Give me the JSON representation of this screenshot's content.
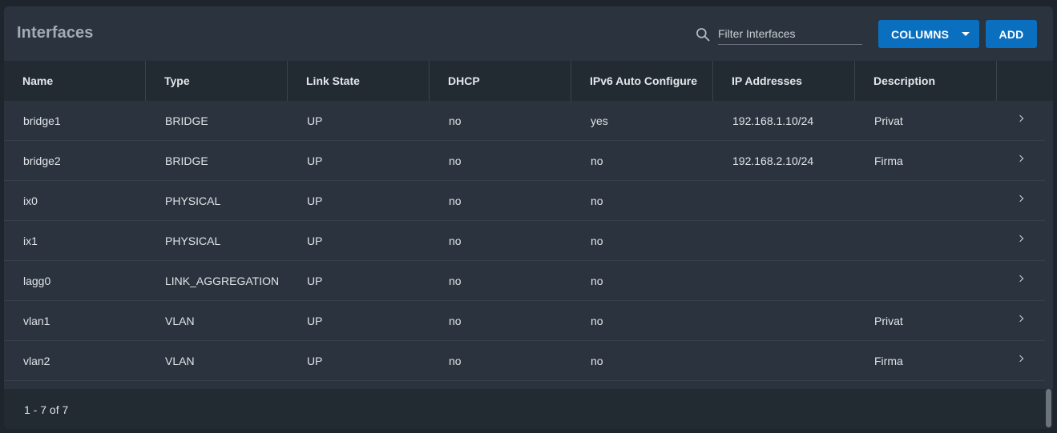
{
  "header": {
    "title": "Interfaces",
    "filter_placeholder": "Filter Interfaces",
    "columns_label": "COLUMNS",
    "add_label": "ADD"
  },
  "table": {
    "columns": [
      "Name",
      "Type",
      "Link State",
      "DHCP",
      "IPv6 Auto Configure",
      "IP Addresses",
      "Description"
    ],
    "rows": [
      [
        "bridge1",
        "BRIDGE",
        "UP",
        "no",
        "yes",
        "192.168.1.10/24",
        "Privat"
      ],
      [
        "bridge2",
        "BRIDGE",
        "UP",
        "no",
        "no",
        "192.168.2.10/24",
        "Firma"
      ],
      [
        "ix0",
        "PHYSICAL",
        "UP",
        "no",
        "no",
        "",
        ""
      ],
      [
        "ix1",
        "PHYSICAL",
        "UP",
        "no",
        "no",
        "",
        ""
      ],
      [
        "lagg0",
        "LINK_AGGREGATION",
        "UP",
        "no",
        "no",
        "",
        ""
      ],
      [
        "vlan1",
        "VLAN",
        "UP",
        "no",
        "no",
        "",
        "Privat"
      ],
      [
        "vlan2",
        "VLAN",
        "UP",
        "no",
        "no",
        "",
        "Firma"
      ]
    ]
  },
  "footer": {
    "pagination": "1 - 7 of 7"
  },
  "icons": {
    "search": "search-icon",
    "dropdown": "chevron-down-icon",
    "row_expand": "chevron-right-icon"
  },
  "colors": {
    "accent": "#0b6fc0",
    "background": "#2b343e",
    "header_bg": "#222a32"
  }
}
